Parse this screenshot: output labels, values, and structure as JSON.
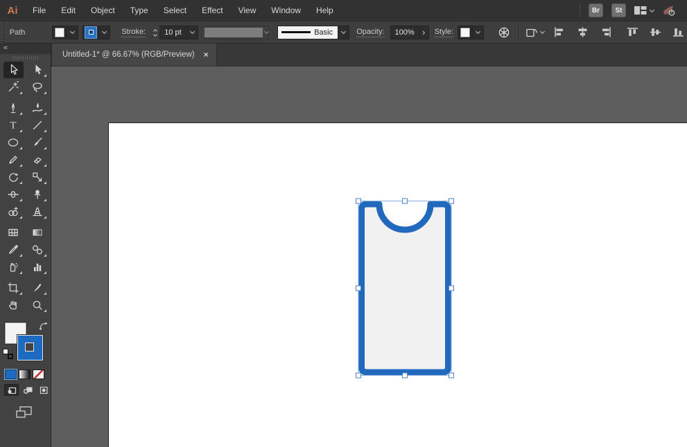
{
  "menubar": {
    "logo": "Ai",
    "items": [
      "File",
      "Edit",
      "Object",
      "Type",
      "Select",
      "Effect",
      "View",
      "Window",
      "Help"
    ],
    "bridge_button": "Br",
    "stock_button": "St"
  },
  "controlbar": {
    "context_label": "Path",
    "stroke_label": "Stroke:",
    "stroke_weight": "10 pt",
    "brush_definition": "Basic",
    "opacity_label": "Opacity:",
    "opacity_value": "100%",
    "opacity_arrow": "›",
    "style_label": "Style:"
  },
  "document_tab": {
    "title": "Untitled-1* @ 66.67% (RGB/Preview)",
    "close_glyph": "×"
  },
  "tools_panel": {
    "collapse_glyph": "«",
    "type_tool_glyph": "T",
    "active_tool": "selection",
    "tools": [
      "selection",
      "direct-selection",
      "magic-wand",
      "lasso",
      "pen",
      "curvature",
      "type",
      "line-segment",
      "ellipse",
      "paintbrush",
      "pencil",
      "eraser",
      "rotate",
      "scale",
      "width",
      "puppet-warp",
      "shape-builder",
      "perspective-grid",
      "mesh",
      "gradient",
      "eyedropper",
      "blend",
      "symbol-sprayer",
      "column-graph",
      "artboard",
      "slice",
      "hand",
      "zoom"
    ],
    "fill_color": "#ffffff",
    "stroke_color": "#1d6bc0",
    "active_proxy": "stroke"
  },
  "canvas": {
    "shape": {
      "description": "rounded rectangle with concave semicircular notch at top",
      "fill": "#f1f1f1",
      "stroke": "#2169bd",
      "stroke_weight": "10 pt",
      "selected": true
    }
  },
  "colors": {
    "accent_blue": "#2169bd",
    "selection_handle_border": "#4a82c8",
    "canvas_gray": "#5d5d5d",
    "panel_gray": "#424242",
    "chrome_gray": "#323232",
    "logo_orange": "#cd7a4f"
  }
}
